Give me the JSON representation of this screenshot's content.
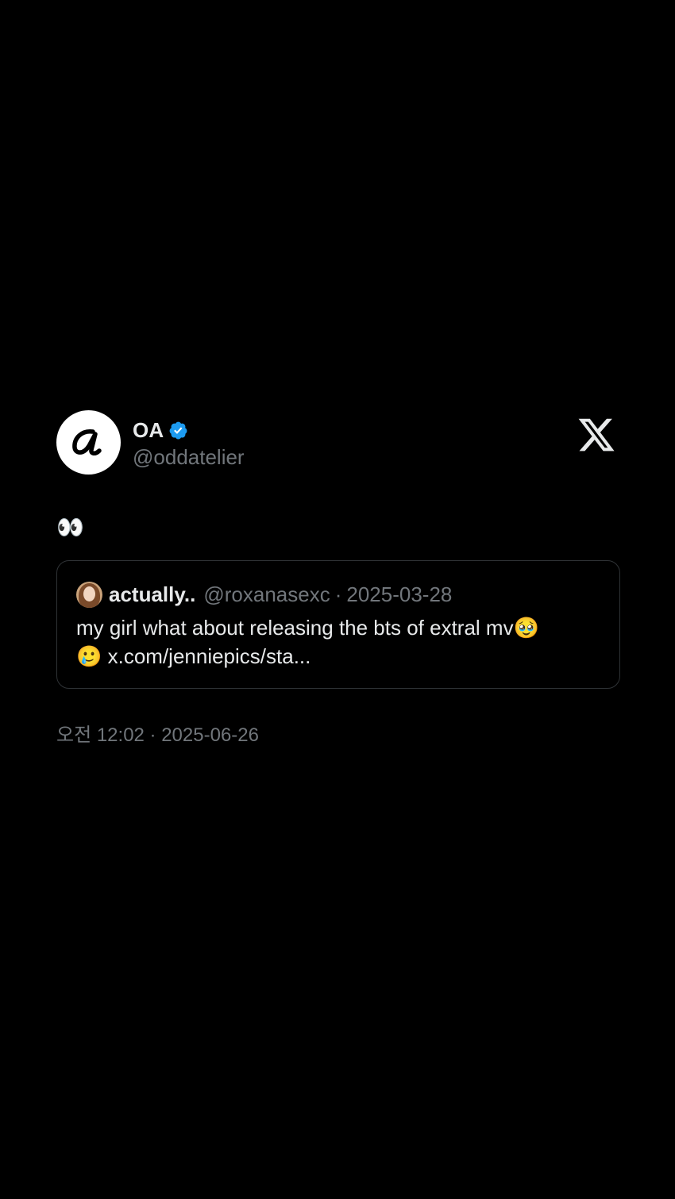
{
  "tweet": {
    "display_name": "OA",
    "handle": "@oddatelier",
    "body": "👀",
    "timestamp": "오전 12:02 · 2025-06-26",
    "quoted": {
      "display_name": "actually..",
      "handle": "@roxanasexc",
      "separator": "·",
      "date": "2025-03-28",
      "text_line1": "my girl what about releasing the bts of extral mv🥹",
      "text_line2": "🥲 x.com/jenniepics/sta..."
    }
  },
  "icons": {
    "avatar": "oa-logo-icon",
    "verified": "verified-badge-icon",
    "platform": "x-logo-icon"
  },
  "colors": {
    "background": "#000000",
    "primary_text": "#e7e9ea",
    "secondary_text": "#71767b",
    "verified_blue": "#1d9bf0",
    "border": "#2f3336"
  }
}
